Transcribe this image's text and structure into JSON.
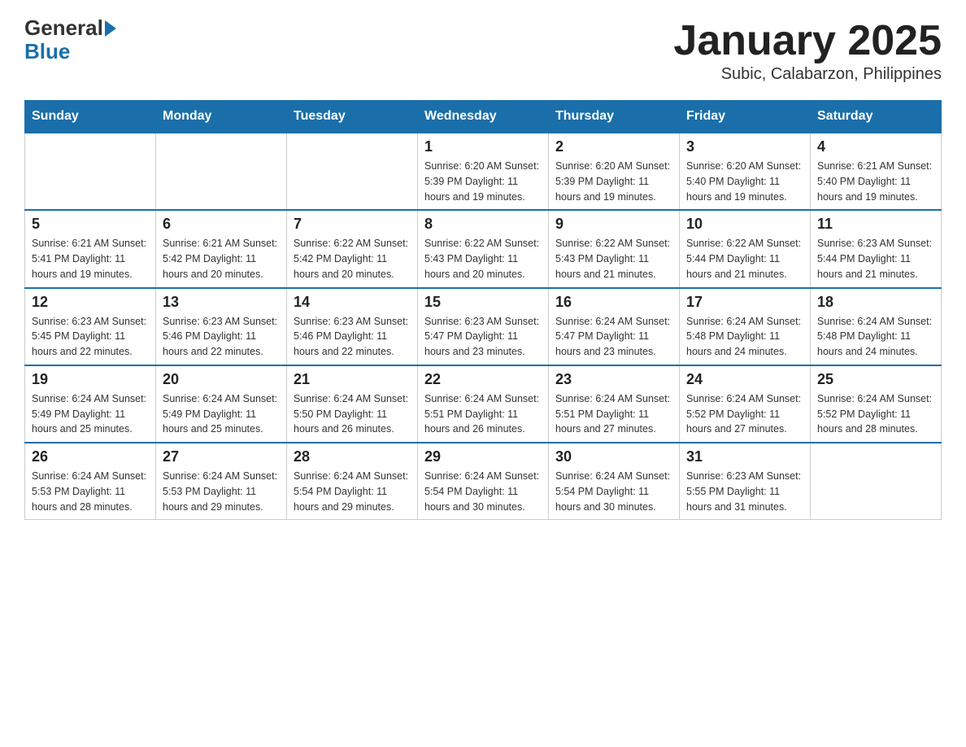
{
  "logo": {
    "general": "General",
    "blue": "Blue"
  },
  "title": "January 2025",
  "subtitle": "Subic, Calabarzon, Philippines",
  "days_of_week": [
    "Sunday",
    "Monday",
    "Tuesday",
    "Wednesday",
    "Thursday",
    "Friday",
    "Saturday"
  ],
  "weeks": [
    [
      {
        "day": "",
        "info": ""
      },
      {
        "day": "",
        "info": ""
      },
      {
        "day": "",
        "info": ""
      },
      {
        "day": "1",
        "info": "Sunrise: 6:20 AM\nSunset: 5:39 PM\nDaylight: 11 hours and 19 minutes."
      },
      {
        "day": "2",
        "info": "Sunrise: 6:20 AM\nSunset: 5:39 PM\nDaylight: 11 hours and 19 minutes."
      },
      {
        "day": "3",
        "info": "Sunrise: 6:20 AM\nSunset: 5:40 PM\nDaylight: 11 hours and 19 minutes."
      },
      {
        "day": "4",
        "info": "Sunrise: 6:21 AM\nSunset: 5:40 PM\nDaylight: 11 hours and 19 minutes."
      }
    ],
    [
      {
        "day": "5",
        "info": "Sunrise: 6:21 AM\nSunset: 5:41 PM\nDaylight: 11 hours and 19 minutes."
      },
      {
        "day": "6",
        "info": "Sunrise: 6:21 AM\nSunset: 5:42 PM\nDaylight: 11 hours and 20 minutes."
      },
      {
        "day": "7",
        "info": "Sunrise: 6:22 AM\nSunset: 5:42 PM\nDaylight: 11 hours and 20 minutes."
      },
      {
        "day": "8",
        "info": "Sunrise: 6:22 AM\nSunset: 5:43 PM\nDaylight: 11 hours and 20 minutes."
      },
      {
        "day": "9",
        "info": "Sunrise: 6:22 AM\nSunset: 5:43 PM\nDaylight: 11 hours and 21 minutes."
      },
      {
        "day": "10",
        "info": "Sunrise: 6:22 AM\nSunset: 5:44 PM\nDaylight: 11 hours and 21 minutes."
      },
      {
        "day": "11",
        "info": "Sunrise: 6:23 AM\nSunset: 5:44 PM\nDaylight: 11 hours and 21 minutes."
      }
    ],
    [
      {
        "day": "12",
        "info": "Sunrise: 6:23 AM\nSunset: 5:45 PM\nDaylight: 11 hours and 22 minutes."
      },
      {
        "day": "13",
        "info": "Sunrise: 6:23 AM\nSunset: 5:46 PM\nDaylight: 11 hours and 22 minutes."
      },
      {
        "day": "14",
        "info": "Sunrise: 6:23 AM\nSunset: 5:46 PM\nDaylight: 11 hours and 22 minutes."
      },
      {
        "day": "15",
        "info": "Sunrise: 6:23 AM\nSunset: 5:47 PM\nDaylight: 11 hours and 23 minutes."
      },
      {
        "day": "16",
        "info": "Sunrise: 6:24 AM\nSunset: 5:47 PM\nDaylight: 11 hours and 23 minutes."
      },
      {
        "day": "17",
        "info": "Sunrise: 6:24 AM\nSunset: 5:48 PM\nDaylight: 11 hours and 24 minutes."
      },
      {
        "day": "18",
        "info": "Sunrise: 6:24 AM\nSunset: 5:48 PM\nDaylight: 11 hours and 24 minutes."
      }
    ],
    [
      {
        "day": "19",
        "info": "Sunrise: 6:24 AM\nSunset: 5:49 PM\nDaylight: 11 hours and 25 minutes."
      },
      {
        "day": "20",
        "info": "Sunrise: 6:24 AM\nSunset: 5:49 PM\nDaylight: 11 hours and 25 minutes."
      },
      {
        "day": "21",
        "info": "Sunrise: 6:24 AM\nSunset: 5:50 PM\nDaylight: 11 hours and 26 minutes."
      },
      {
        "day": "22",
        "info": "Sunrise: 6:24 AM\nSunset: 5:51 PM\nDaylight: 11 hours and 26 minutes."
      },
      {
        "day": "23",
        "info": "Sunrise: 6:24 AM\nSunset: 5:51 PM\nDaylight: 11 hours and 27 minutes."
      },
      {
        "day": "24",
        "info": "Sunrise: 6:24 AM\nSunset: 5:52 PM\nDaylight: 11 hours and 27 minutes."
      },
      {
        "day": "25",
        "info": "Sunrise: 6:24 AM\nSunset: 5:52 PM\nDaylight: 11 hours and 28 minutes."
      }
    ],
    [
      {
        "day": "26",
        "info": "Sunrise: 6:24 AM\nSunset: 5:53 PM\nDaylight: 11 hours and 28 minutes."
      },
      {
        "day": "27",
        "info": "Sunrise: 6:24 AM\nSunset: 5:53 PM\nDaylight: 11 hours and 29 minutes."
      },
      {
        "day": "28",
        "info": "Sunrise: 6:24 AM\nSunset: 5:54 PM\nDaylight: 11 hours and 29 minutes."
      },
      {
        "day": "29",
        "info": "Sunrise: 6:24 AM\nSunset: 5:54 PM\nDaylight: 11 hours and 30 minutes."
      },
      {
        "day": "30",
        "info": "Sunrise: 6:24 AM\nSunset: 5:54 PM\nDaylight: 11 hours and 30 minutes."
      },
      {
        "day": "31",
        "info": "Sunrise: 6:23 AM\nSunset: 5:55 PM\nDaylight: 11 hours and 31 minutes."
      },
      {
        "day": "",
        "info": ""
      }
    ]
  ]
}
